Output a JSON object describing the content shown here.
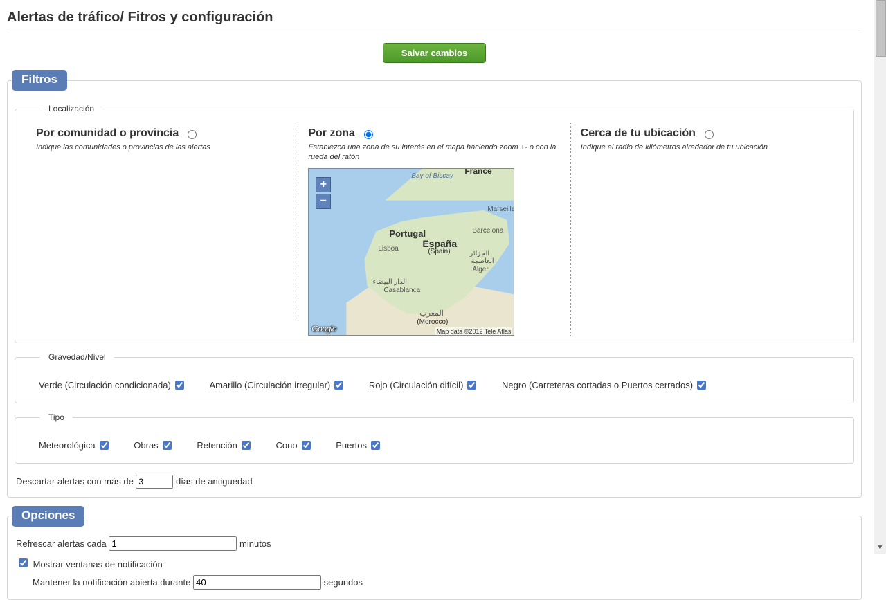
{
  "pageTitle": "Alertas de tráfico/ Fitros y configuración",
  "saveLabel": "Salvar cambios",
  "filtros": {
    "legend": "Filtros",
    "localizacion": {
      "legend": "Localización",
      "porComunidad": {
        "title": "Por comunidad o provincia",
        "desc": "Indique las comunidades o provincias de las alertas"
      },
      "porZona": {
        "title": "Por zona",
        "desc": "Establezca una zona de su interés en el mapa haciendo zoom +- o con la rueda del ratón"
      },
      "cercaUbicacion": {
        "title": "Cerca de tu ubicación",
        "desc": "Indique el radio de kilómetros alrededor de tu ubicación"
      },
      "selected": "porZona",
      "map": {
        "attribution": "Map data ©2012 Tele Atlas",
        "logo": "Google",
        "labels": {
          "france": "France",
          "biscay": "Bay of Biscay",
          "portugal": "Portugal",
          "lisboa": "Lisboa",
          "espana": "España",
          "spain": "(Spain)",
          "barcelona": "Barcelona",
          "marseille": "Marseille",
          "casablanca": "Casablanca",
          "casablanca_ar": "الدار البيضاء",
          "alger": "Alger",
          "alger_ar": "الجزائر",
          "alger_sub": "العاصمة",
          "morocco": "(Morocco)",
          "morocco_ar": "المغرب"
        }
      }
    },
    "gravedad": {
      "legend": "Gravedad/Nivel",
      "items": [
        {
          "label": "Verde (Circulación condicionada)",
          "checked": true
        },
        {
          "label": "Amarillo (Circulación irregular)",
          "checked": true
        },
        {
          "label": "Rojo (Circulación difícil)",
          "checked": true
        },
        {
          "label": "Negro (Carreteras cortadas o Puertos cerrados)",
          "checked": true
        }
      ]
    },
    "tipo": {
      "legend": "Tipo",
      "items": [
        {
          "label": "Meteorológica",
          "checked": true
        },
        {
          "label": "Obras",
          "checked": true
        },
        {
          "label": "Retención",
          "checked": true
        },
        {
          "label": "Cono",
          "checked": true
        },
        {
          "label": "Puertos",
          "checked": true
        }
      ]
    },
    "descartar": {
      "pre": "Descartar alertas con más de",
      "value": "3",
      "post": "días de antiguedad"
    }
  },
  "opciones": {
    "legend": "Opciones",
    "refrescar": {
      "pre": "Refrescar alertas cada",
      "value": "1",
      "post": "minutos"
    },
    "mostrarNotif": {
      "label": "Mostrar ventanas de notificación",
      "checked": true
    },
    "mantener": {
      "pre": "Mantener la notificación abierta durante",
      "value": "40",
      "post": "segundos"
    }
  }
}
